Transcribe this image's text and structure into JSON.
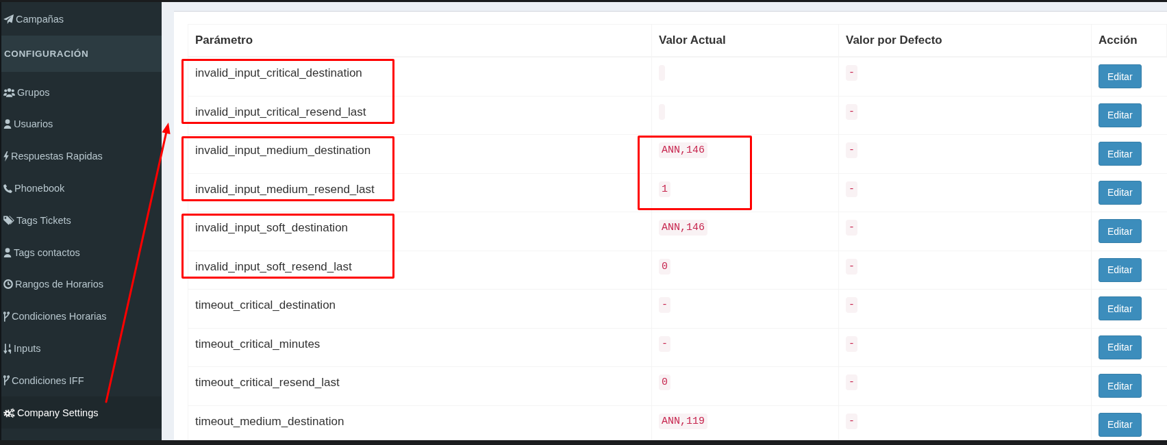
{
  "sidebar": {
    "items": [
      {
        "kind": "link",
        "label": "Campañas",
        "selected": false
      },
      {
        "kind": "header",
        "label": "CONFIGURACIÓN"
      },
      {
        "kind": "link",
        "label": "Grupos",
        "selected": false
      },
      {
        "kind": "link",
        "label": "Usuarios",
        "selected": false
      },
      {
        "kind": "link",
        "label": "Respuestas Rapidas",
        "selected": false
      },
      {
        "kind": "link",
        "label": "Phonebook",
        "selected": false
      },
      {
        "kind": "link",
        "label": "Tags Tickets",
        "selected": false
      },
      {
        "kind": "link",
        "label": "Tags contactos",
        "selected": false
      },
      {
        "kind": "link",
        "label": "Rangos de Horarios",
        "selected": false
      },
      {
        "kind": "link",
        "label": "Condiciones Horarias",
        "selected": false
      },
      {
        "kind": "link",
        "label": "Inputs",
        "selected": false
      },
      {
        "kind": "link",
        "label": "Condiciones IFF",
        "selected": false
      },
      {
        "kind": "link",
        "label": "Company Settings",
        "selected": true
      }
    ]
  },
  "annotation_arrow": true,
  "table": {
    "columns": [
      "Parámetro",
      "Valor Actual",
      "Valor por Defecto",
      "Acción"
    ],
    "row_groups": [
      {
        "parameter_marked": true,
        "value_marked": false,
        "rows": [
          {
            "parameter": "invalid_input_critical_destination",
            "default_value": "-",
            "action": "Editar"
          },
          {
            "parameter": "invalid_input_critical_resend_last",
            "default_value": "-",
            "action": "Editar"
          }
        ]
      },
      {
        "parameter_marked": true,
        "value_marked": true,
        "rows": [
          {
            "parameter": "invalid_input_medium_destination",
            "current_value": "ANN,146",
            "default_value": "-",
            "action": "Editar"
          },
          {
            "parameter": "invalid_input_medium_resend_last",
            "current_value": "1",
            "default_value": "-",
            "action": "Editar"
          }
        ]
      },
      {
        "parameter_marked": true,
        "value_marked": false,
        "rows": [
          {
            "parameter": "invalid_input_soft_destination",
            "current_value": "ANN,146",
            "default_value": "-",
            "action": "Editar"
          },
          {
            "parameter": "invalid_input_soft_resend_last",
            "current_value": "0",
            "default_value": "-",
            "action": "Editar"
          }
        ]
      },
      {
        "parameter_marked": false,
        "value_marked": false,
        "rows": [
          {
            "parameter": "timeout_critical_destination",
            "current_value": "-",
            "default_value": "-",
            "action": "Editar"
          },
          {
            "parameter": "timeout_critical_minutes",
            "current_value": "-",
            "default_value": "-",
            "action": "Editar"
          },
          {
            "parameter": "timeout_critical_resend_last",
            "current_value": "0",
            "default_value": "-",
            "action": "Editar"
          },
          {
            "parameter": "timeout_medium_destination",
            "current_value": "ANN,119",
            "default_value": "-",
            "action": "Editar"
          }
        ]
      }
    ]
  }
}
